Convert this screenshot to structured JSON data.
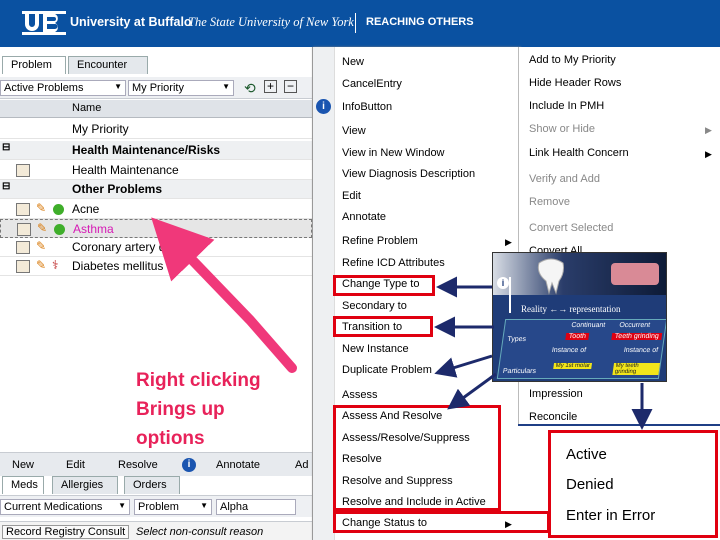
{
  "header": {
    "logo": "UB",
    "university": "University at Buffalo",
    "subtitle": "The State University of New York",
    "tagline": "REACHING OTHERS"
  },
  "left_panel": {
    "tabs": [
      "Problem",
      "Encounter"
    ],
    "filter": "Active Problems",
    "view": "My Priority",
    "column_name": "Name",
    "rows": [
      {
        "label": "My Priority",
        "type": "group-header"
      },
      {
        "label": "Health Maintenance/Risks",
        "type": "group"
      },
      {
        "label": "Health Maintenance",
        "type": "item"
      },
      {
        "label": "Other Problems",
        "type": "group"
      },
      {
        "label": "Acne",
        "type": "item"
      },
      {
        "label": "Asthma",
        "type": "item-selected"
      },
      {
        "label": "Coronary artery disease",
        "type": "item"
      },
      {
        "label": "Diabetes mellitus",
        "type": "item"
      }
    ],
    "actions": [
      "New",
      "Edit",
      "Resolve",
      "Annotate",
      "Ad"
    ],
    "bottom_tabs": [
      "Meds",
      "Allergies",
      "Orders"
    ],
    "bottom_filters": [
      "Current Medications",
      "Problem",
      "Alpha"
    ],
    "consult_row": [
      "Record Registry Consult",
      "Select non-consult reason"
    ]
  },
  "annotation": {
    "line1": "Right clicking",
    "line2": "Brings up",
    "line3": "options"
  },
  "menu_primary": {
    "items": [
      "New",
      "CancelEntry",
      "InfoButton",
      "View",
      "View in New Window",
      "View Diagnosis Description",
      "Edit",
      "Annotate",
      "Refine Problem",
      "Refine ICD Attributes",
      "Change Type to",
      "Secondary to",
      "Transition to",
      "New Instance",
      "Duplicate Problem",
      "Assess",
      "Assess And Resolve",
      "Assess/Resolve/Suppress",
      "Resolve",
      "Resolve and Suppress",
      "Resolve and Include in Active",
      "Change Status to"
    ]
  },
  "menu_secondary": {
    "items": [
      "Add to My Priority",
      "Hide Header Rows",
      "Include In PMH",
      "Show or Hide",
      "Link Health Concern",
      "Verify and Add",
      "Remove",
      "Convert Selected",
      "Convert All",
      "Impression",
      "Reconcile"
    ]
  },
  "inset": {
    "caption": "Reality ←→ representation",
    "cols": [
      "Continuant",
      "Occurrent"
    ],
    "rows": [
      "Types",
      "Particulars"
    ],
    "cells": [
      "Tooth",
      "Teeth grinding",
      "Instance of",
      "Instance of",
      "My 1st molar",
      "My teeth grinding"
    ]
  },
  "status_menu": {
    "items": [
      "Active",
      "Denied",
      "Enter in Error"
    ]
  },
  "colors": {
    "header": "#0a51a1",
    "highlight_box": "#e00010",
    "annotation": "#e8225a",
    "arrow": "#1d2a6b"
  }
}
